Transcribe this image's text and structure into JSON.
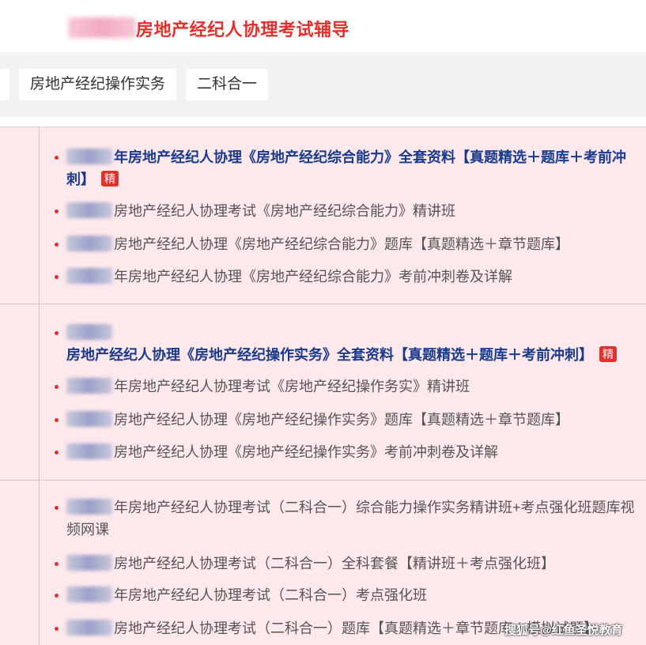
{
  "header": {
    "title": "房地产经纪人协理考试辅导"
  },
  "tabs": [
    {
      "label": "房地产经纪操作实务"
    },
    {
      "label": "二科合一"
    }
  ],
  "sections": [
    {
      "items": [
        {
          "text": "年房地产经纪人协理《房地产经纪综合能力》全套资料【真题精选＋题库＋考前冲刺】",
          "featured": true,
          "badge": "精"
        },
        {
          "text": "房地产经纪人协理考试《房地产经纪综合能力》精讲班"
        },
        {
          "text": "房地产经纪人协理《房地产经纪综合能力》题库【真题精选＋章节题库】"
        },
        {
          "text": "年房地产经纪人协理《房地产经纪综合能力》考前冲刺卷及详解"
        }
      ]
    },
    {
      "items": [
        {
          "text": "房地产经纪人协理《房地产经纪操作实务》全套资料【真题精选＋题库＋考前冲刺】",
          "featured": true,
          "badge": "精"
        },
        {
          "text": "年房地产经纪人协理考试《房地产经纪操作务实》精讲班"
        },
        {
          "text": "房地产经纪人协理《房地产经纪操作实务》题库【真题精选＋章节题库】"
        },
        {
          "text": "房地产经纪人协理《房地产经纪操作实务》考前冲刺卷及详解"
        }
      ]
    },
    {
      "items": [
        {
          "text": "年房地产经纪人协理考试（二科合一）综合能力操作实务精讲班+考点强化班题库视频网课"
        },
        {
          "text": "房地产经纪人协理考试（二科合一）全科套餐【精讲班＋考点强化班】"
        },
        {
          "text": "年房地产经纪人协理考试（二科合一）考点强化班"
        },
        {
          "text": "房地产经纪人协理考试（二科合一）题库【真题精选＋章节题库＋模拟试题】"
        }
      ]
    }
  ],
  "watermark": "搜狐号@红鱼圣悦教育"
}
